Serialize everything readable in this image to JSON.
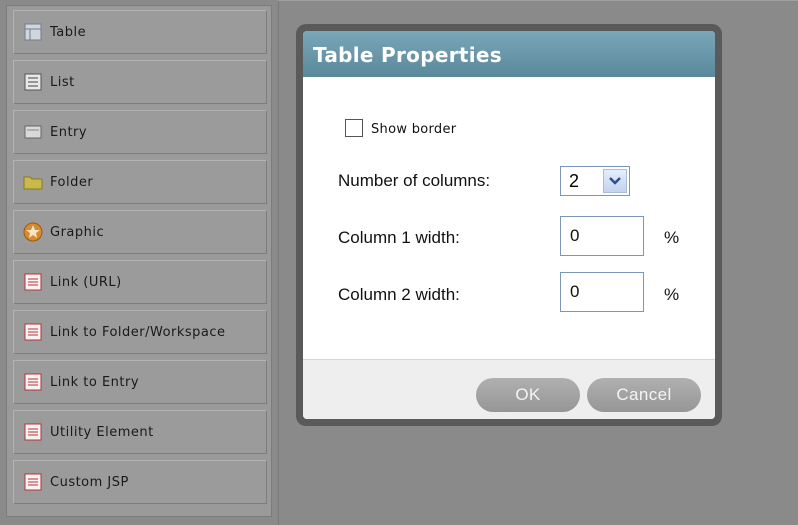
{
  "palette": {
    "items": [
      {
        "label": "Table",
        "icon": "table-icon"
      },
      {
        "label": "List",
        "icon": "list-icon"
      },
      {
        "label": "Entry",
        "icon": "entry-icon"
      },
      {
        "label": "Folder",
        "icon": "folder-icon"
      },
      {
        "label": "Graphic",
        "icon": "graphic-icon"
      },
      {
        "label": "Link (URL)",
        "icon": "link-url-icon"
      },
      {
        "label": "Link to Folder/Workspace",
        "icon": "link-folder-icon"
      },
      {
        "label": "Link to Entry",
        "icon": "link-entry-icon"
      },
      {
        "label": "Utility Element",
        "icon": "utility-element-icon"
      },
      {
        "label": "Custom JSP",
        "icon": "custom-jsp-icon"
      }
    ]
  },
  "dialog": {
    "title": "Table Properties",
    "show_border_label": "Show border",
    "show_border_checked": false,
    "columns_label": "Number of columns:",
    "columns_value": "2",
    "col1_label": "Column 1 width:",
    "col1_value": "0",
    "col2_label": "Column 2 width:",
    "col2_value": "0",
    "percent": "%",
    "ok_label": "OK",
    "cancel_label": "Cancel"
  },
  "colors": {
    "title_bar": "#6a98ab",
    "button": "#a4a4a4",
    "background": "#8a8a8a"
  }
}
